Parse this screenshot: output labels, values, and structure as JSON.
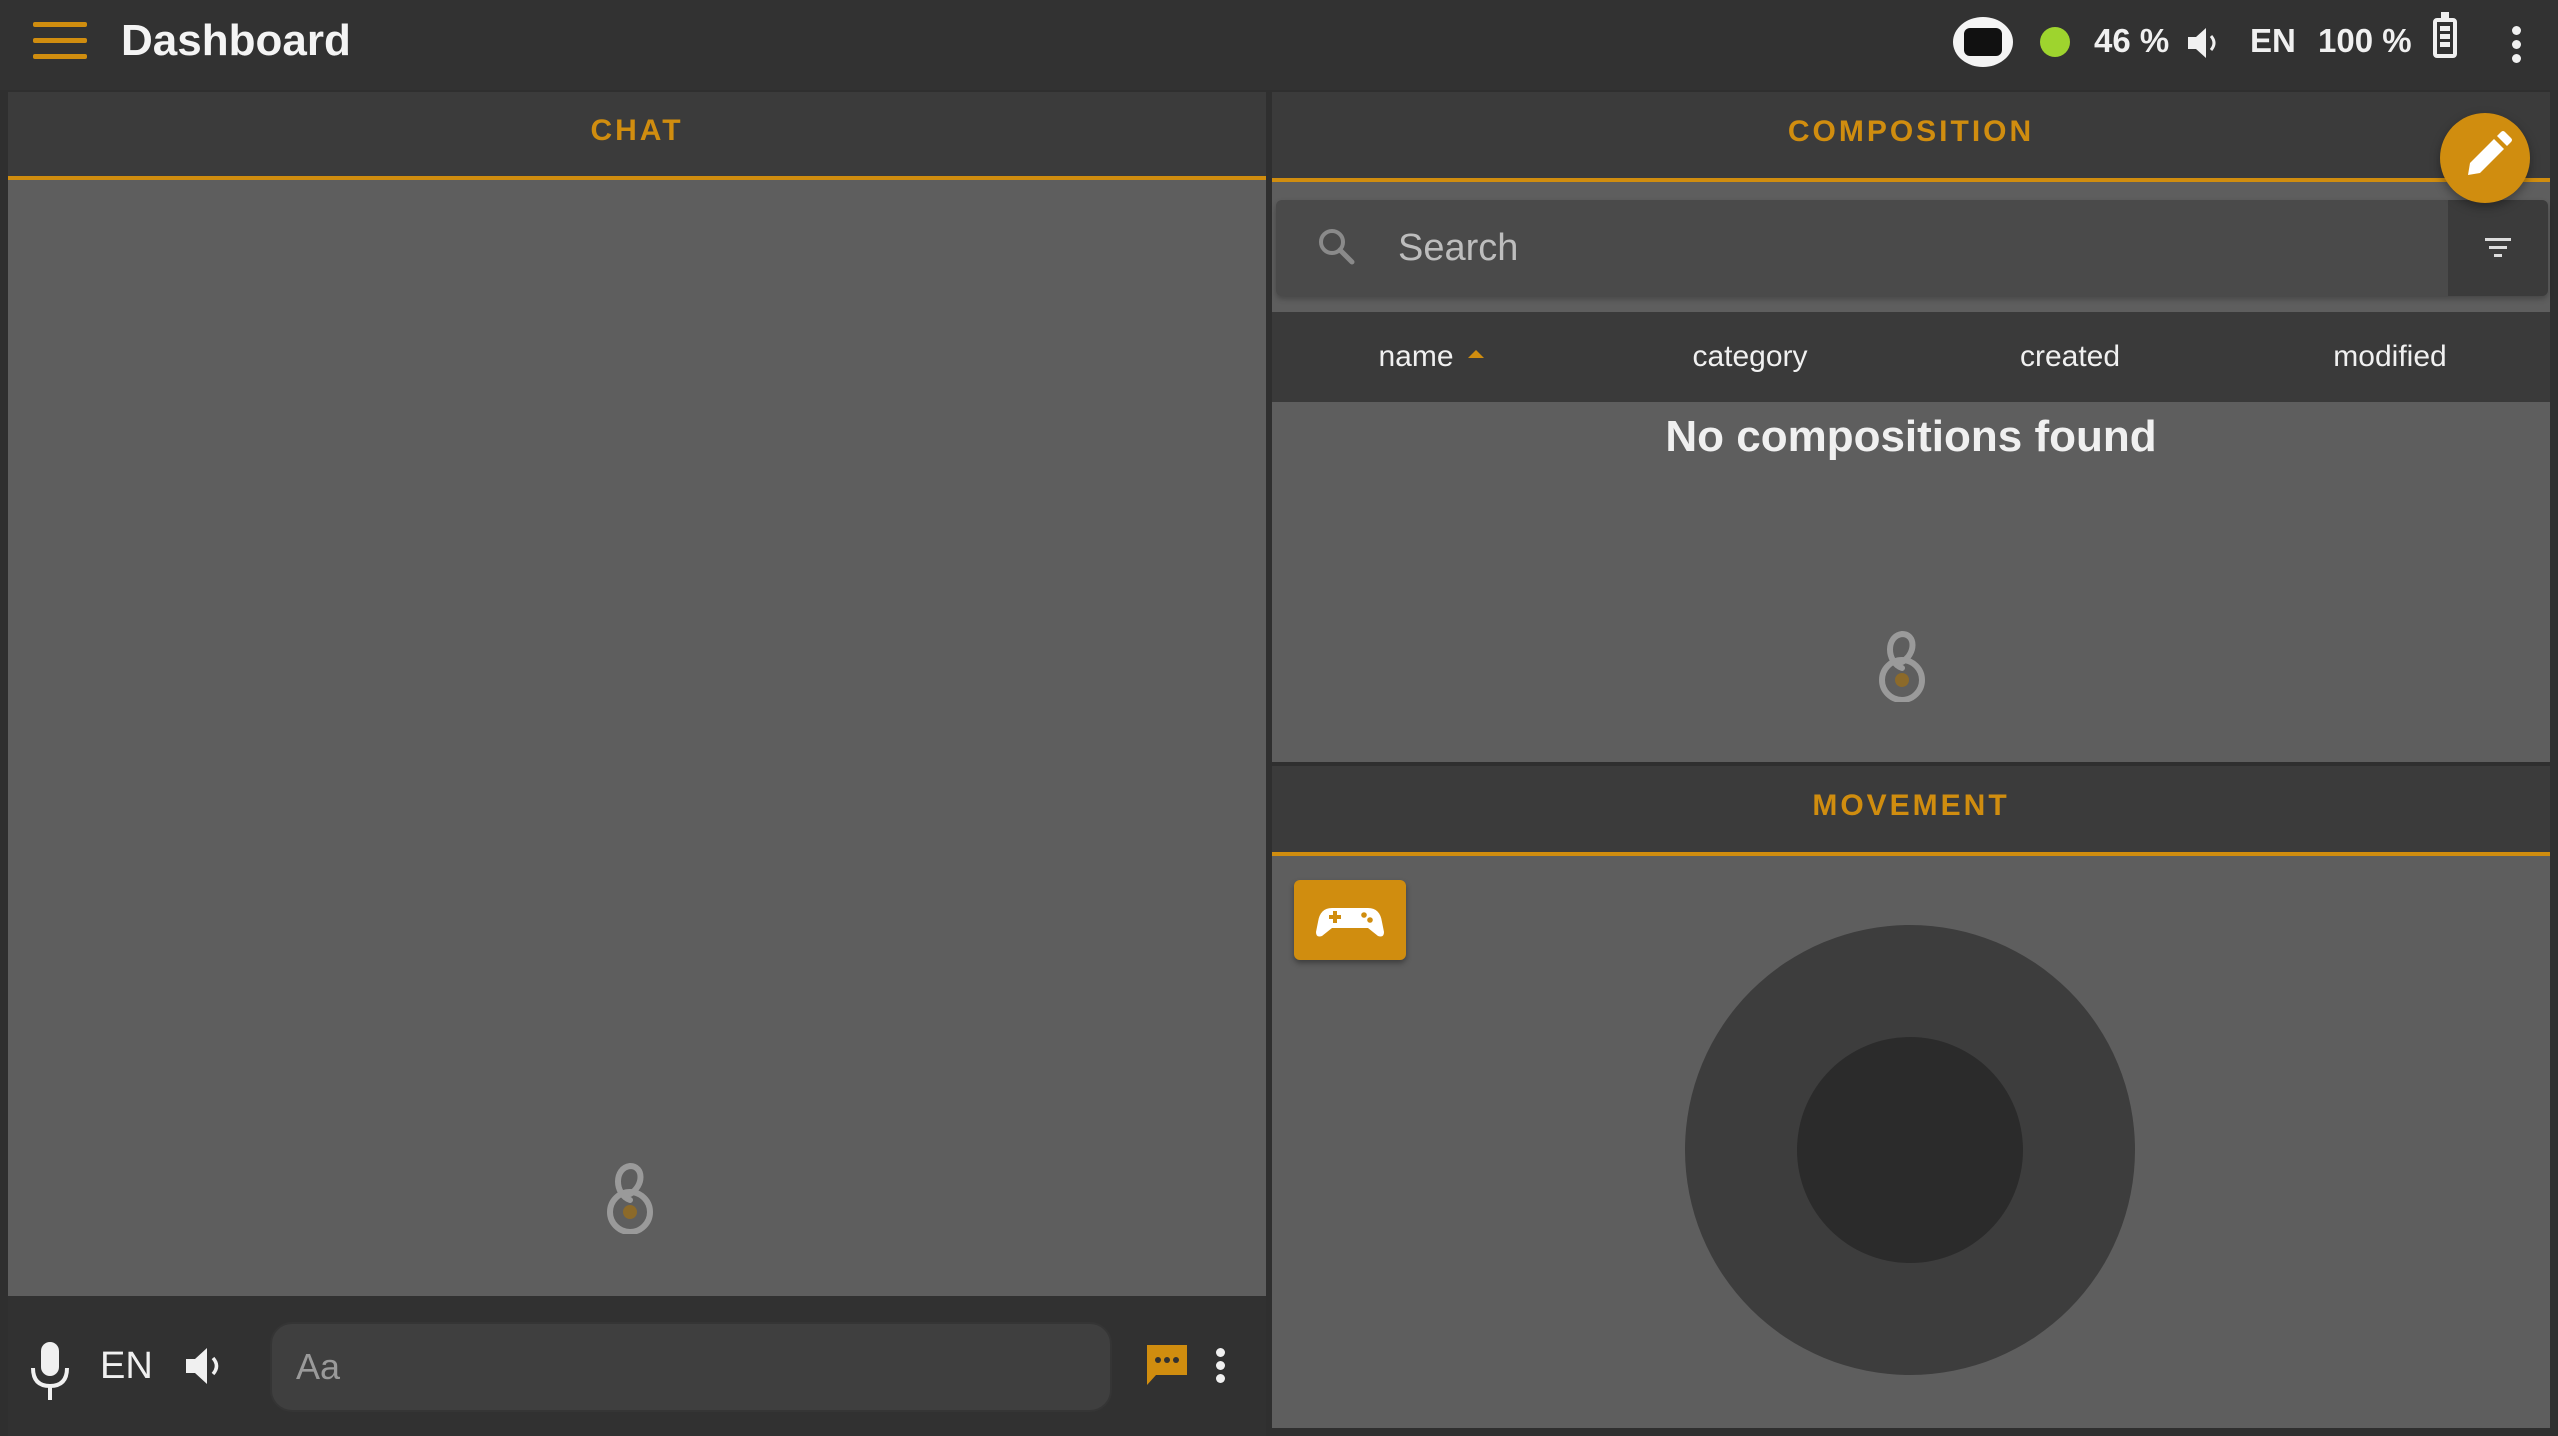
{
  "app": {
    "title": "Dashboard"
  },
  "status": {
    "connection_color": "#9ed42e",
    "volume": "46 %",
    "language": "EN",
    "battery": "100 %"
  },
  "chat": {
    "title": "CHAT",
    "footer_language": "EN",
    "input_placeholder": "Aa"
  },
  "composition": {
    "title": "COMPOSITION",
    "search_placeholder": "Search",
    "columns": [
      "name",
      "category",
      "created",
      "modified"
    ],
    "sorted_by": "name",
    "empty_message": "No compositions found"
  },
  "movement": {
    "title": "MOVEMENT"
  },
  "colors": {
    "accent": "#d08d0f",
    "panel": "#5e5e5e",
    "header": "#3b3b3b"
  }
}
